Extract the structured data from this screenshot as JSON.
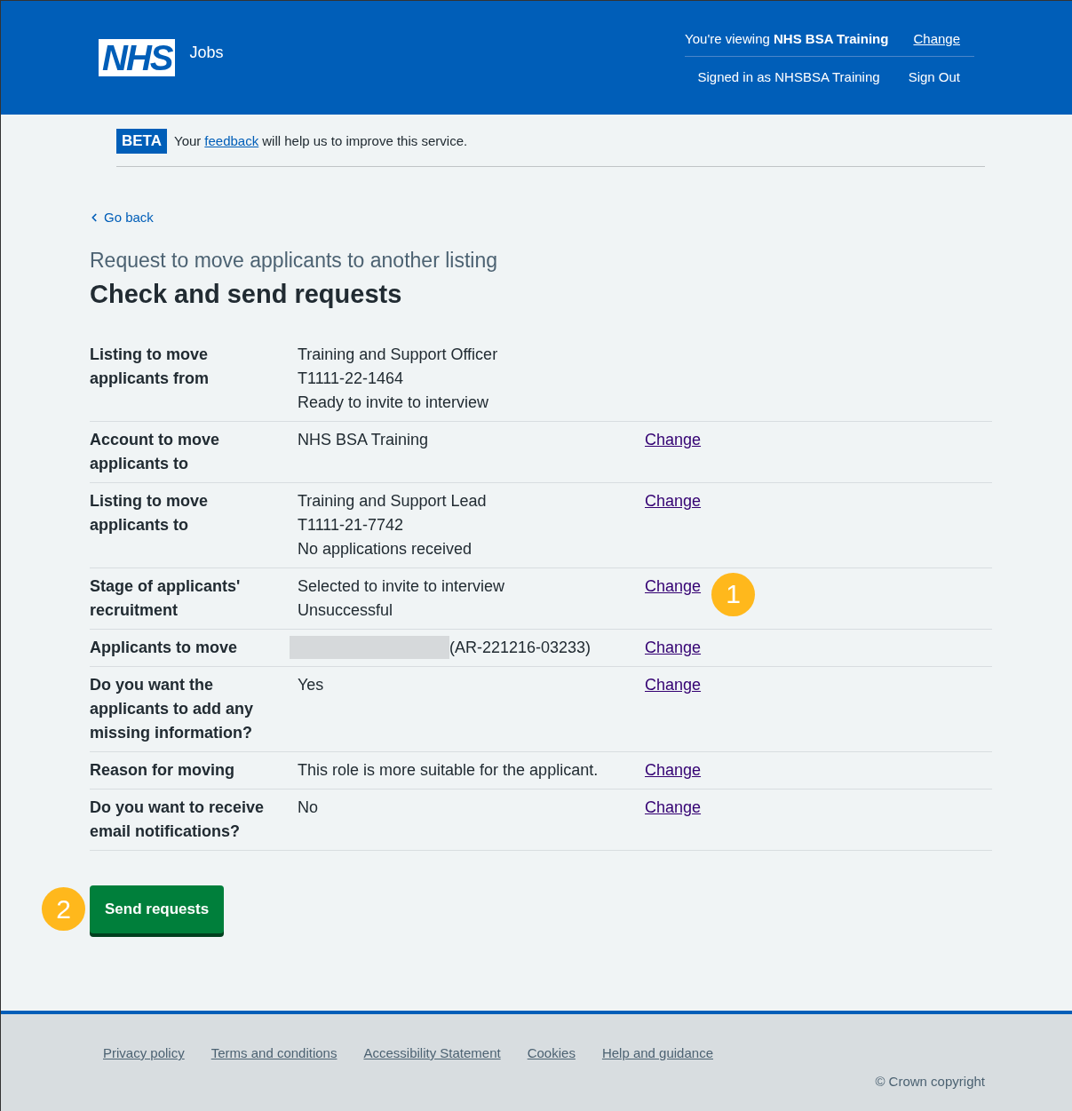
{
  "header": {
    "logo": "NHS",
    "service": "Jobs",
    "viewing": "You're viewing **NHS BSA Training**",
    "viewing_link": "Change",
    "signed_in": "Signed in as NHSBSA Training",
    "sign_out": "Sign Out"
  },
  "phase_banner": {
    "tag": "BETA",
    "before": "Your",
    "link": "feedback",
    "after": "will help us to improve this service."
  },
  "back_link": "Go back",
  "caption": "Request to move applicants to another listing",
  "heading": "Check and send requests",
  "rows": [
    {
      "key": "Listing to move applicants from",
      "values": [
        "Training and Support Officer",
        "T1111-22-1464",
        "Ready to invite to interview"
      ]
    },
    {
      "key": "Account to move applicants to",
      "values": [
        "NHS BSA Training"
      ],
      "action": "Change"
    },
    {
      "key": "Listing to move applicants to",
      "values": [
        "Training and Support Lead",
        "T1111-21-7742",
        "No applications received"
      ],
      "action": "Change"
    },
    {
      "key": "Stage of applicants' recruitment",
      "values": [
        "Selected to invite to interview",
        "Unsuccessful"
      ],
      "action": "Change",
      "callout": "1"
    },
    {
      "key": "Applicants to move",
      "values": [
        "(AR-221216-03233)"
      ],
      "action": "Change",
      "redacted": true
    },
    {
      "key": "Do you want the applicants to add any missing information?",
      "values": [
        "Yes"
      ],
      "action": "Change"
    },
    {
      "key": "Reason for moving",
      "values": [
        "This role is more suitable for the applicant."
      ],
      "action": "Change"
    },
    {
      "key": "Do you want to receive email notifications?",
      "values": [
        "No"
      ],
      "action": "Change"
    }
  ],
  "submit": {
    "label": "Send requests",
    "callout": "2"
  },
  "footer": {
    "links": [
      "Privacy policy",
      "Terms and conditions",
      "Accessibility Statement",
      "Cookies",
      "Help and guidance"
    ],
    "copyright": "© Crown copyright"
  }
}
